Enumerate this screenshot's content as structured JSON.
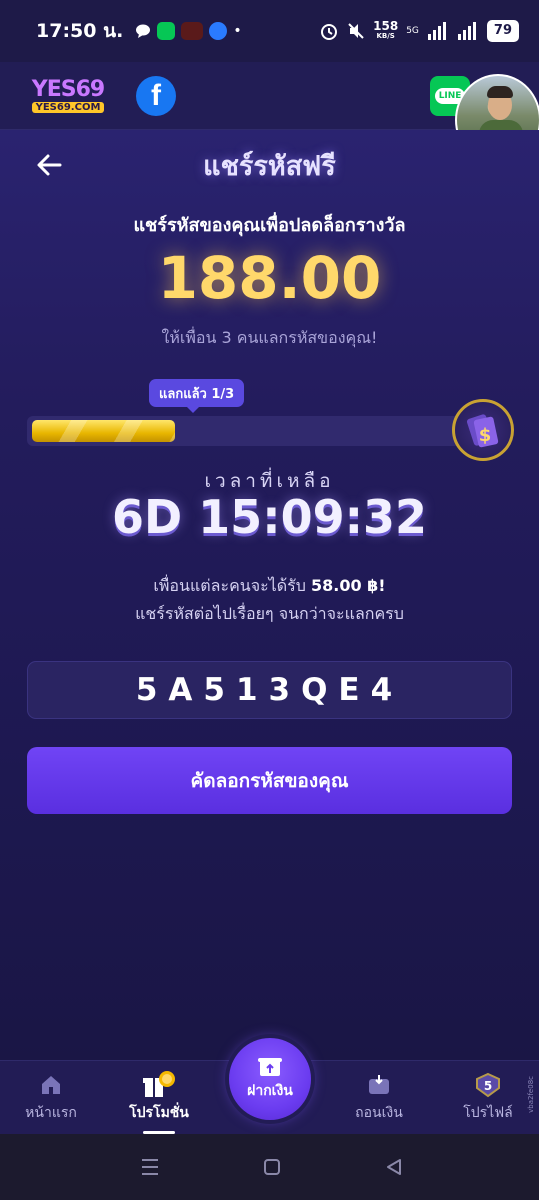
{
  "status_bar": {
    "time": "17:50 น.",
    "network_speed": "158",
    "network_unit": "KB/S",
    "network_type": "5G",
    "battery": "79"
  },
  "header": {
    "logo_text": "YES69",
    "logo_sub": "YES69.COM",
    "facebook_icon": "facebook-icon",
    "line_label": "LINE",
    "plus_label": "+",
    "plus_count": "3"
  },
  "page": {
    "title": "แชร์รหัสฟรี",
    "subtitle": "แชร์รหัสของคุณเพื่อปลดล็อกรางวัล",
    "reward_amount": "188.00",
    "invite_text": "ให้เพื่อน 3 คนแลกรหัสของคุณ!",
    "redeemed_label": "แลกแล้ว 1/3",
    "progress_fraction": 0.3333,
    "time_left_label": "เวลาที่เหลือ",
    "countdown": "6D 15:09:32",
    "reward_line_prefix": "เพื่อนแต่ละคนจะได้รับ",
    "reward_line_amount": "58.00 ฿!",
    "keep_sharing": "แชร์รหัสต่อไปเรื่อยๆ จนกว่าจะแลกครบ",
    "code": "5A513QE4",
    "copy_button": "คัดลอกรหัสของคุณ"
  },
  "bottom_nav": {
    "home": "หน้าแรก",
    "promotion": "โปรโมชั่น",
    "deposit": "ฝากเงิน",
    "withdraw": "ถอนเงิน",
    "profile": "โปรไฟล์",
    "profile_level": "5"
  },
  "side_text": "vba2fe08c",
  "colors": {
    "accent": "#6b3cf0",
    "gold": "#ffd86b",
    "background": "#231c5c"
  }
}
